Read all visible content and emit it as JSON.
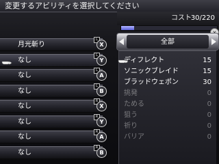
{
  "header": {
    "title": "変更するアビリティを選択してください"
  },
  "cost": {
    "label": "コスト",
    "value": "30/220",
    "fraction": 0.136
  },
  "filter": {
    "label": "全部",
    "close_glyph": "×"
  },
  "slots": [
    {
      "label": "月光斬り",
      "button": "X",
      "shoulder": "L"
    },
    {
      "label": "なし",
      "button": "Y",
      "shoulder": "L"
    },
    {
      "label": "なし",
      "button": "A",
      "shoulder": "L"
    },
    {
      "label": "なし",
      "button": "B",
      "shoulder": "L"
    },
    {
      "label": "なし",
      "button": "X",
      "shoulder": "R"
    },
    {
      "label": "なし",
      "button": "Y",
      "shoulder": "R"
    },
    {
      "label": "なし",
      "button": "A",
      "shoulder": "R"
    },
    {
      "label": "なし",
      "button": "B",
      "shoulder": "R"
    }
  ],
  "abilities": [
    {
      "name": "ディフレクト",
      "cost": "15",
      "enabled": true
    },
    {
      "name": "ソニックブレイド",
      "cost": "15",
      "enabled": true
    },
    {
      "name": "ブラッドウェポン",
      "cost": "30",
      "enabled": true
    },
    {
      "name": "挑発",
      "cost": "0",
      "enabled": false
    },
    {
      "name": "ためる",
      "cost": "0",
      "enabled": false
    },
    {
      "name": "狙う",
      "cost": "0",
      "enabled": false
    },
    {
      "name": "祈り",
      "cost": "0",
      "enabled": false
    },
    {
      "name": "バリア",
      "cost": "0",
      "enabled": false
    }
  ]
}
